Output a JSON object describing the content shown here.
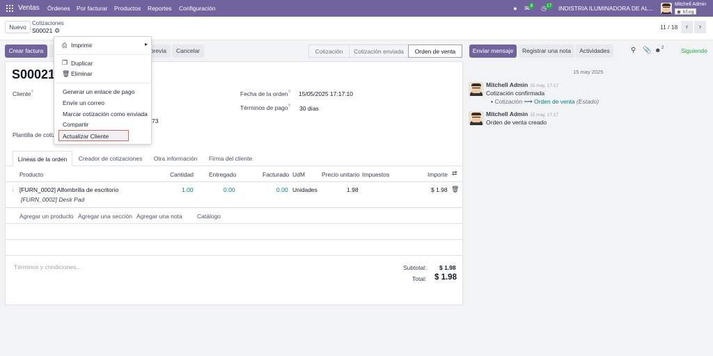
{
  "navbar": {
    "app_name": "Ventas",
    "menus": [
      "Órdenes",
      "Por facturar",
      "Productos",
      "Reportes",
      "Configuración"
    ],
    "messages_badge": "6",
    "activities_badge": "17",
    "company": "INDISTRIA ILUMINADORA DE AL...",
    "user_name": "Mitchell Admin",
    "db_name": "blog"
  },
  "control": {
    "new_button": "Nuevo",
    "breadcrumb_parent": "Cotizaciones",
    "breadcrumb_current": "S00021",
    "pager": "11 / 18"
  },
  "actions": {
    "create_invoice": "Crear factura",
    "preview_partial": "previa",
    "cancel": "Cancelar"
  },
  "status_stages": [
    "Cotización",
    "Cotización enviada",
    "Orden de venta"
  ],
  "status_active": "Orden de venta",
  "dropdown": {
    "print": "Imprimir",
    "duplicate": "Duplicar",
    "delete": "Eliminar",
    "generate_link": "Generar un enlace de pago",
    "send_email": "Envíe un correo",
    "mark_sent": "Marcar cotización como enviada",
    "share": "Compartir",
    "update_customer": "Actualizar Cliente"
  },
  "form": {
    "order_name": "S00021",
    "customer_label": "Cliente",
    "customer_partial": "73",
    "template_label": "Plantilla de cotiz",
    "order_date_label": "Fecha de la orden",
    "order_date_value": "15/05/2025 17:17:10",
    "payment_terms_label": "Términos de pago",
    "payment_terms_value": "30 días"
  },
  "tabs": [
    "Líneas de la orden",
    "Creador de cotizaciones",
    "Otra información",
    "Firma del cliente"
  ],
  "table": {
    "headers": [
      "Producto",
      "Cantidad",
      "Entregado",
      "Facturado",
      "UdM",
      "Precio unitario",
      "Impuestos",
      "Importe"
    ],
    "rows": [
      {
        "product": "[FURN_0002] Alfombrilla de escritorio",
        "description": "[FURN_0002] Desk Pad",
        "quantity": "1.00",
        "delivered": "0.00",
        "invoiced": "0.00",
        "uom": "Unidades",
        "unit_price": "1.98",
        "taxes": "",
        "subtotal": "$ 1.98"
      }
    ],
    "add_links": [
      "Agregar un producto",
      "Agregar una sección",
      "Agregar una nota",
      "Catálogo"
    ]
  },
  "totals": {
    "terms_placeholder": "Términos y condiciones...",
    "subtotal_label": "Subtotal:",
    "subtotal_value": "$ 1.98",
    "total_label": "Total:",
    "total_value": "$ 1.98"
  },
  "chatter": {
    "send_message": "Enviar mensaje",
    "log_note": "Registrar una nota",
    "activities": "Actividades",
    "followers_count": "2",
    "following": "Siguiendo",
    "date_separator": "15 may 2025",
    "messages": [
      {
        "author": "Mitchell Admin",
        "time": "15 may, 17:17",
        "text": "Cotización confirmada",
        "tracking_old": "Cotización",
        "tracking_new": "Orden de venta",
        "tracking_field": "(Estado)"
      },
      {
        "author": "Mitchell Admin",
        "time": "15 may, 17:17",
        "text": "Orden de venta creado"
      }
    ]
  },
  "colors": {
    "brand": "#71639e",
    "link": "#017e84",
    "following": "#28a745",
    "highlight_border": "#e05d5d"
  }
}
